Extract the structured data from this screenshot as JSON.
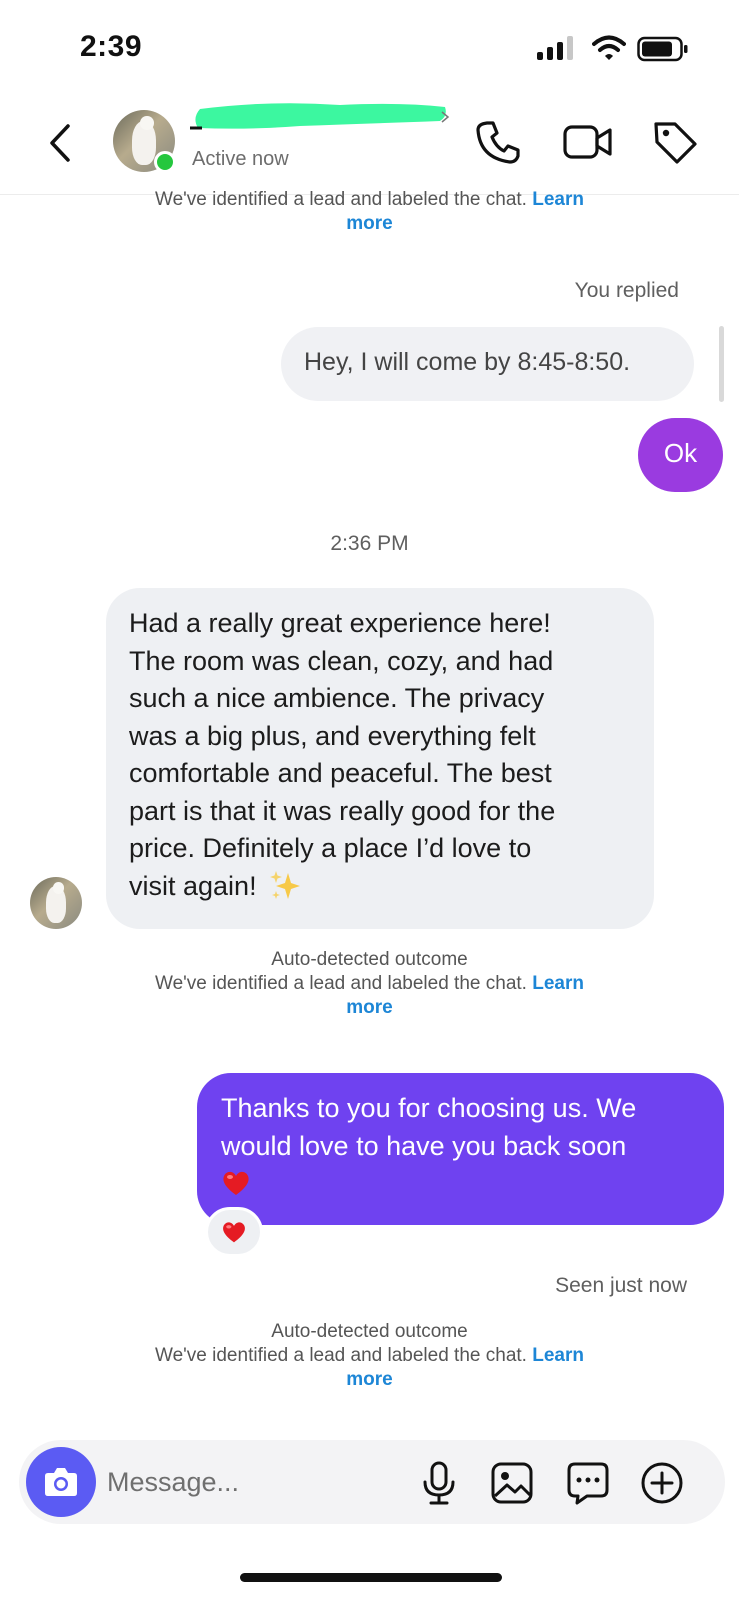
{
  "status_bar": {
    "time": "2:39",
    "signal_bars": 4,
    "signal_active": 3
  },
  "header": {
    "active_status": "Active now",
    "avatar_icon": "swan-profile-photo",
    "icons": [
      "back-chevron-icon",
      "phone-icon",
      "video-camera-icon",
      "tag-icon"
    ]
  },
  "chat": {
    "top_note": {
      "text": "We've identified a lead and labeled the chat.",
      "link_part1": "Learn",
      "link_part2": "more"
    },
    "you_replied_label": "You replied",
    "replied_message": "Hey, I will come by 8:45-8:50.",
    "ok_message": "Ok",
    "timestamp": "2:36 PM",
    "incoming_message": {
      "lines": [
        "Had a really great experience here!",
        "The room was clean, cozy, and had",
        "such a nice ambience. The privacy",
        "was a big plus, and everything felt",
        "comfortable and peaceful. The best",
        "part is that it was really good for the",
        "price. Definitely a place I’d love to",
        "visit again!"
      ],
      "emoji": "sparkles"
    },
    "outcome_note_1": {
      "title": "Auto-detected outcome",
      "text": "We've identified a lead and labeled the chat.",
      "link_part1": "Learn",
      "link_part2": "more"
    },
    "outgoing_message": {
      "lines": [
        "Thanks to you for choosing us. We",
        "would love to have you back soon"
      ],
      "emoji": "red-heart"
    },
    "reaction": "red-heart",
    "seen_label": "Seen just now",
    "outcome_note_2": {
      "title": "Auto-detected outcome",
      "text": "We've identified a lead and labeled the chat.",
      "link_part1": "Learn",
      "link_part2": "more"
    }
  },
  "composer": {
    "placeholder": "Message...",
    "icons": [
      "camera-icon",
      "microphone-icon",
      "gallery-icon",
      "sticker-icon",
      "plus-icon"
    ]
  },
  "colors": {
    "outgoing_purple": "#6f42f0",
    "ok_bubble": "#9a3be0",
    "incoming_gray": "#eef0f3",
    "link_blue": "#1d86d6",
    "online_green": "#25c73e",
    "camera_button": "#5b5bf3",
    "redaction_green": "#3cf7a0"
  }
}
